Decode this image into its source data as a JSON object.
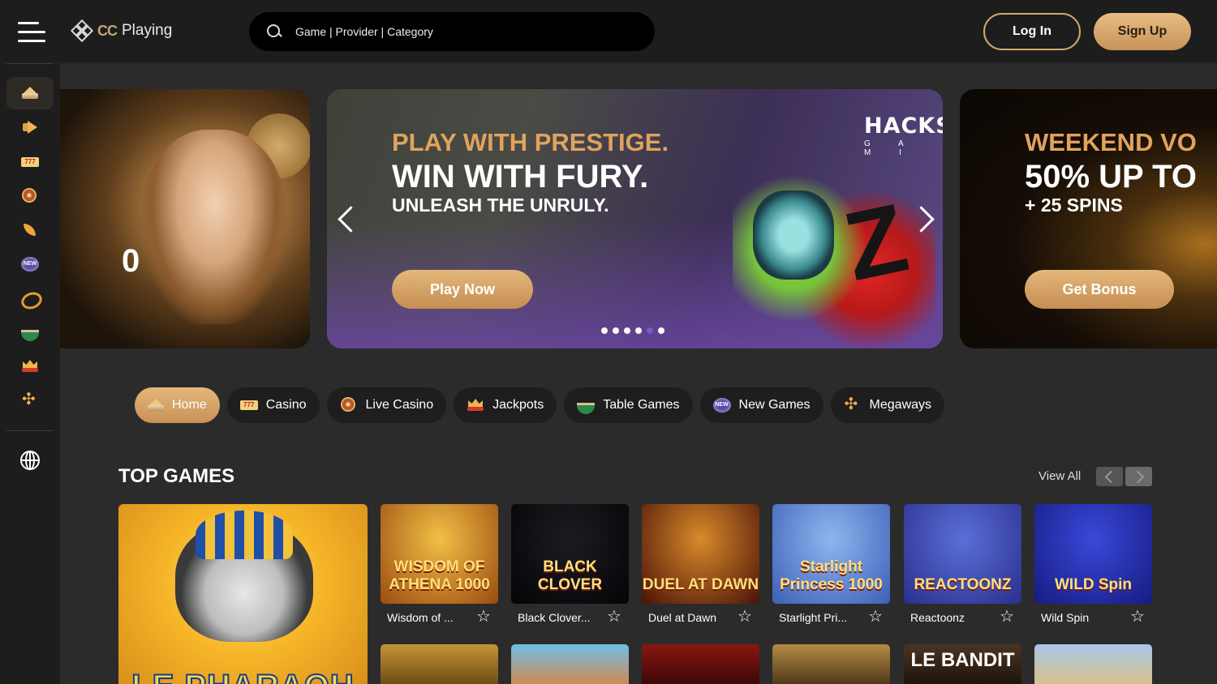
{
  "header": {
    "logo_cc": "CC",
    "logo_text": "Playing",
    "search_placeholder": "Game | Provider | Category",
    "login_label": "Log In",
    "signup_label": "Sign Up"
  },
  "sidebar": {
    "items": [
      {
        "icon": "home-icon",
        "active": true
      },
      {
        "icon": "megaphone-icon"
      },
      {
        "icon": "slot-777-icon"
      },
      {
        "icon": "roulette-icon"
      },
      {
        "icon": "leaf-icon"
      },
      {
        "icon": "new-badge-icon"
      },
      {
        "icon": "ring-icon"
      },
      {
        "icon": "poker-table-icon"
      },
      {
        "icon": "crown-icon"
      },
      {
        "icon": "flower-icon"
      }
    ],
    "language_icon": "globe-icon"
  },
  "banners": {
    "left": {
      "partial_text": "0"
    },
    "center": {
      "brand": "HACKSA",
      "brand_sub": "G A M I",
      "line1": "PLAY WITH PRESTIGE.",
      "line2": "WIN WITH FURY.",
      "line3": "UNLEASH THE UNRULY.",
      "button": "Play Now",
      "dots": [
        false,
        false,
        false,
        false,
        true,
        false
      ]
    },
    "right": {
      "line1": "WEEKEND VO",
      "line2": "50% UP TO",
      "line3": "+ 25 SPINS",
      "button": "Get Bonus"
    }
  },
  "tabs": [
    {
      "label": "Home",
      "icon": "home-icon",
      "active": true
    },
    {
      "label": "Casino",
      "icon": "slot-777-icon"
    },
    {
      "label": "Live Casino",
      "icon": "roulette-icon"
    },
    {
      "label": "Jackpots",
      "icon": "crown-icon"
    },
    {
      "label": "Table Games",
      "icon": "poker-table-icon"
    },
    {
      "label": "New Games",
      "icon": "new-badge-icon"
    },
    {
      "label": "Megaways",
      "icon": "flower-icon"
    }
  ],
  "top_games": {
    "title": "TOP GAMES",
    "view_all": "View All",
    "featured": {
      "title": "LE PHARAOH"
    },
    "games": [
      {
        "name": "Wisdom of ...",
        "thumb_text": "WISDOM OF ATHENA 1000",
        "colors": [
          "#f2c046",
          "#9b4b10"
        ]
      },
      {
        "name": "Black Clover...",
        "thumb_text": "BLACK CLOVER",
        "colors": [
          "#1b1b22",
          "#050507"
        ]
      },
      {
        "name": "Duel at Dawn",
        "thumb_text": "DUEL AT DAWN",
        "colors": [
          "#d98a2a",
          "#4a1208"
        ]
      },
      {
        "name": "Starlight Pri...",
        "thumb_text": "Starlight Princess 1000",
        "colors": [
          "#8fb6ee",
          "#3d5fb8"
        ]
      },
      {
        "name": "Reactoonz",
        "thumb_text": "REACTOONZ",
        "colors": [
          "#5a6fd8",
          "#2a2f8c"
        ]
      },
      {
        "name": "Wild Spin",
        "thumb_text": "WILD Spin",
        "colors": [
          "#3a48d8",
          "#151c82"
        ]
      }
    ],
    "row2_colors": [
      [
        "#c79536",
        "#5b3b10"
      ],
      [
        "#6fc0e8",
        "#e57e2f"
      ],
      [
        "#8b1712",
        "#2a0504"
      ],
      [
        "#b38b45",
        "#3a2810"
      ],
      [
        "#4a3523",
        "#140d06"
      ],
      [
        "#a8c6e8",
        "#e3c07a"
      ]
    ],
    "row2_texts": [
      "",
      "",
      "",
      "",
      "LE BANDIT",
      ""
    ]
  }
}
